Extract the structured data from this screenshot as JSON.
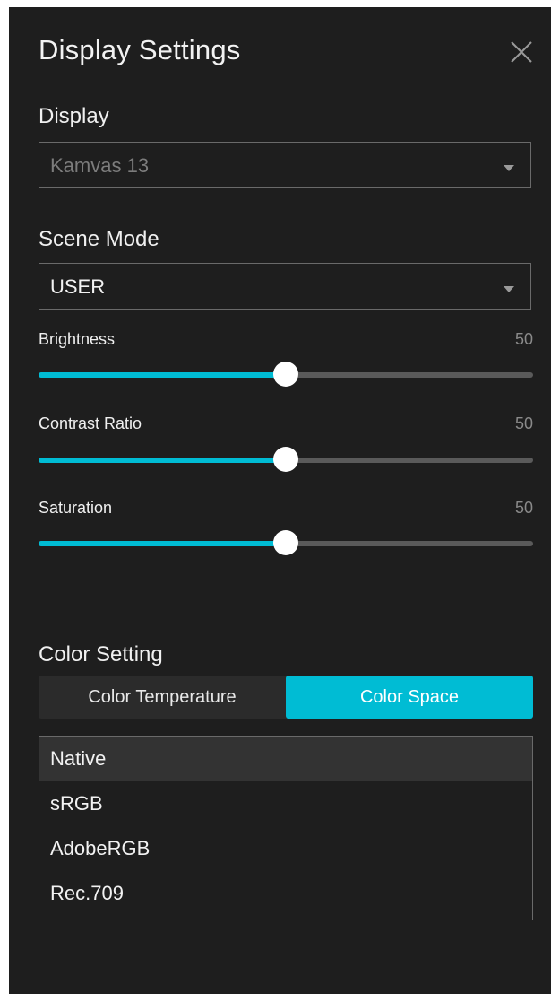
{
  "panel": {
    "title": "Display Settings",
    "close_icon": "close-icon"
  },
  "display": {
    "label": "Display",
    "selected": "Kamvas 13",
    "caret_icon": "caret-down-icon"
  },
  "scene_mode": {
    "label": "Scene Mode",
    "selected": "USER",
    "caret_icon": "caret-down-icon"
  },
  "sliders": [
    {
      "label": "Brightness",
      "value": "50",
      "percent": 50
    },
    {
      "label": "Contrast Ratio",
      "value": "50",
      "percent": 50
    },
    {
      "label": "Saturation",
      "value": "50",
      "percent": 50
    }
  ],
  "color_setting": {
    "label": "Color Setting",
    "tabs": [
      {
        "label": "Color Temperature",
        "active": false
      },
      {
        "label": "Color Space",
        "active": true
      }
    ],
    "options": [
      {
        "label": "Native",
        "selected": true
      },
      {
        "label": "sRGB",
        "selected": false
      },
      {
        "label": "AdobeRGB",
        "selected": false
      },
      {
        "label": "Rec.709",
        "selected": false
      }
    ]
  },
  "colors": {
    "panel_bg": "#1e1e1e",
    "accent": "#00bcd4",
    "track": "#5a5a5a",
    "muted_text": "#8a8a8a",
    "border": "#6a6a6a"
  }
}
